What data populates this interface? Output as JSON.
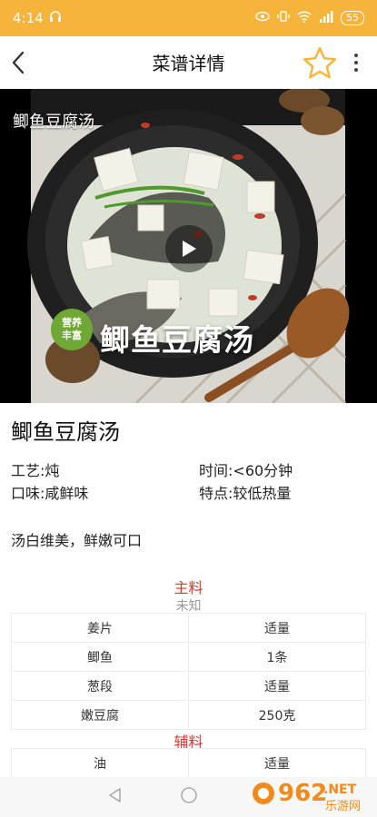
{
  "status_bar": {
    "time": "4:14",
    "battery": "55"
  },
  "header": {
    "title": "菜谱详情"
  },
  "video": {
    "caption": "鲫鱼豆腐汤",
    "overlay_title": "鲫鱼豆腐汤",
    "badge_line1": "营养",
    "badge_line2": "丰富"
  },
  "recipe": {
    "title": "鲫鱼豆腐汤",
    "technique_label": "工艺:",
    "technique_value": "炖",
    "time_label": "时间:",
    "time_value": "<60分钟",
    "taste_label": "口味:",
    "taste_value": "咸鲜味",
    "feature_label": "特点:",
    "feature_value": "较低热量",
    "description": "汤白维美，鲜嫩可口"
  },
  "main_ingredients": {
    "heading": "主料",
    "subheading": "未知",
    "rows": [
      {
        "name": "姜片",
        "amount": "适量"
      },
      {
        "name": "鲫鱼",
        "amount": "1条"
      },
      {
        "name": "葱段",
        "amount": "适量"
      },
      {
        "name": "嫩豆腐",
        "amount": "250克"
      }
    ]
  },
  "aux_ingredients": {
    "heading": "辅料",
    "rows": [
      {
        "name": "油",
        "amount": "适量"
      }
    ]
  },
  "watermark": {
    "text_top": "962",
    "text_dot": ".NET",
    "text_bottom": "乐游网"
  },
  "colors": {
    "status_bar": "#f6b53a",
    "section_heading": "#e0362f",
    "star": "#f6b53a"
  }
}
